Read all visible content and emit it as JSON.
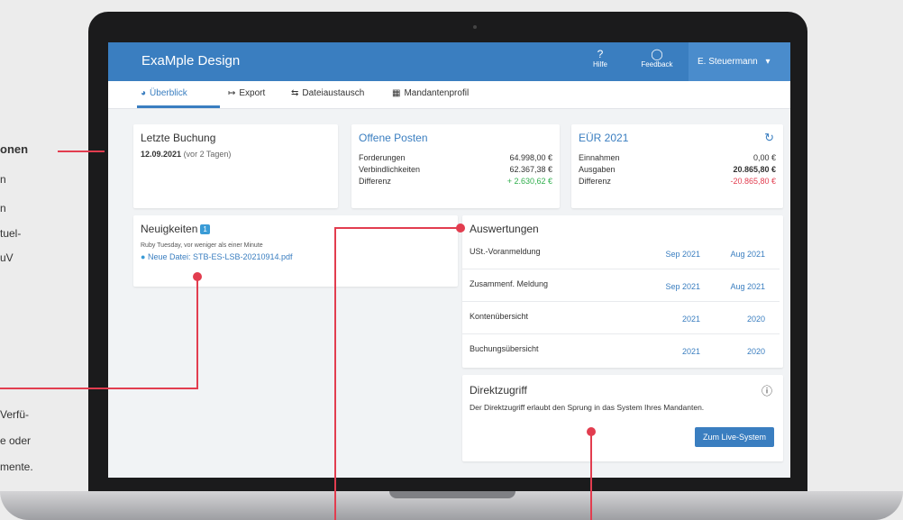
{
  "side_texts": {
    "heading_fragment": "onen",
    "line1": "n",
    "line2": "n",
    "line3": "tuel-",
    "line4": "uV",
    "lower1": "Verfü-",
    "lower2": "e oder",
    "lower3": "mente."
  },
  "app": {
    "name": "ExaMple Design",
    "help_label": "Hilfe",
    "feedback_label": "Feedback",
    "user": "E. Steuermann"
  },
  "tabs": [
    "Überblick",
    "Export",
    "Dateiaustausch",
    "Mandantenprofil"
  ],
  "cards": {
    "letzte_buchung": {
      "title": "Letzte Buchung",
      "date": "12.09.2021",
      "relative": "(vor 2 Tagen)"
    },
    "offene_posten": {
      "title": "Offene Posten",
      "rows": [
        {
          "label": "Forderungen",
          "value": "64.998,00 €"
        },
        {
          "label": "Verbindlichkeiten",
          "value": "62.367,38 €"
        },
        {
          "label": "Differenz",
          "value": "+ 2.630,62 €"
        }
      ]
    },
    "eur": {
      "title": "EÜR 2021",
      "rows": [
        {
          "label": "Einnahmen",
          "value": "0,00 €"
        },
        {
          "label": "Ausgaben",
          "value": "20.865,80 €"
        },
        {
          "label": "Differenz",
          "value": "-20.865,80 €"
        }
      ]
    },
    "neuigkeiten": {
      "title": "Neuigkeiten",
      "badge": "1",
      "meta": "Ruby Tuesday, vor weniger als einer Minute",
      "file": "Neue Datei: STB-ES-LSB-20210914.pdf"
    },
    "auswertungen": {
      "title": "Auswertungen",
      "rows": [
        {
          "label": "USt.-Voranmeldung",
          "a": "Sep 2021",
          "b": "Aug 2021"
        },
        {
          "label": "Zusammenf. Meldung",
          "a": "Sep 2021",
          "b": "Aug 2021"
        },
        {
          "label": "Kontenübersicht",
          "a": "2021",
          "b": "2020"
        },
        {
          "label": "Buchungsübersicht",
          "a": "2021",
          "b": "2020"
        }
      ]
    },
    "direktzugriff": {
      "title": "Direktzugriff",
      "text": "Der Direktzugriff erlaubt den Sprung in das System Ihres Mandanten.",
      "button": "Zum Live-System"
    }
  },
  "colors": {
    "brand": "#3a7ec0",
    "accent_red": "#e23d4f",
    "positive": "#2fae4c"
  }
}
